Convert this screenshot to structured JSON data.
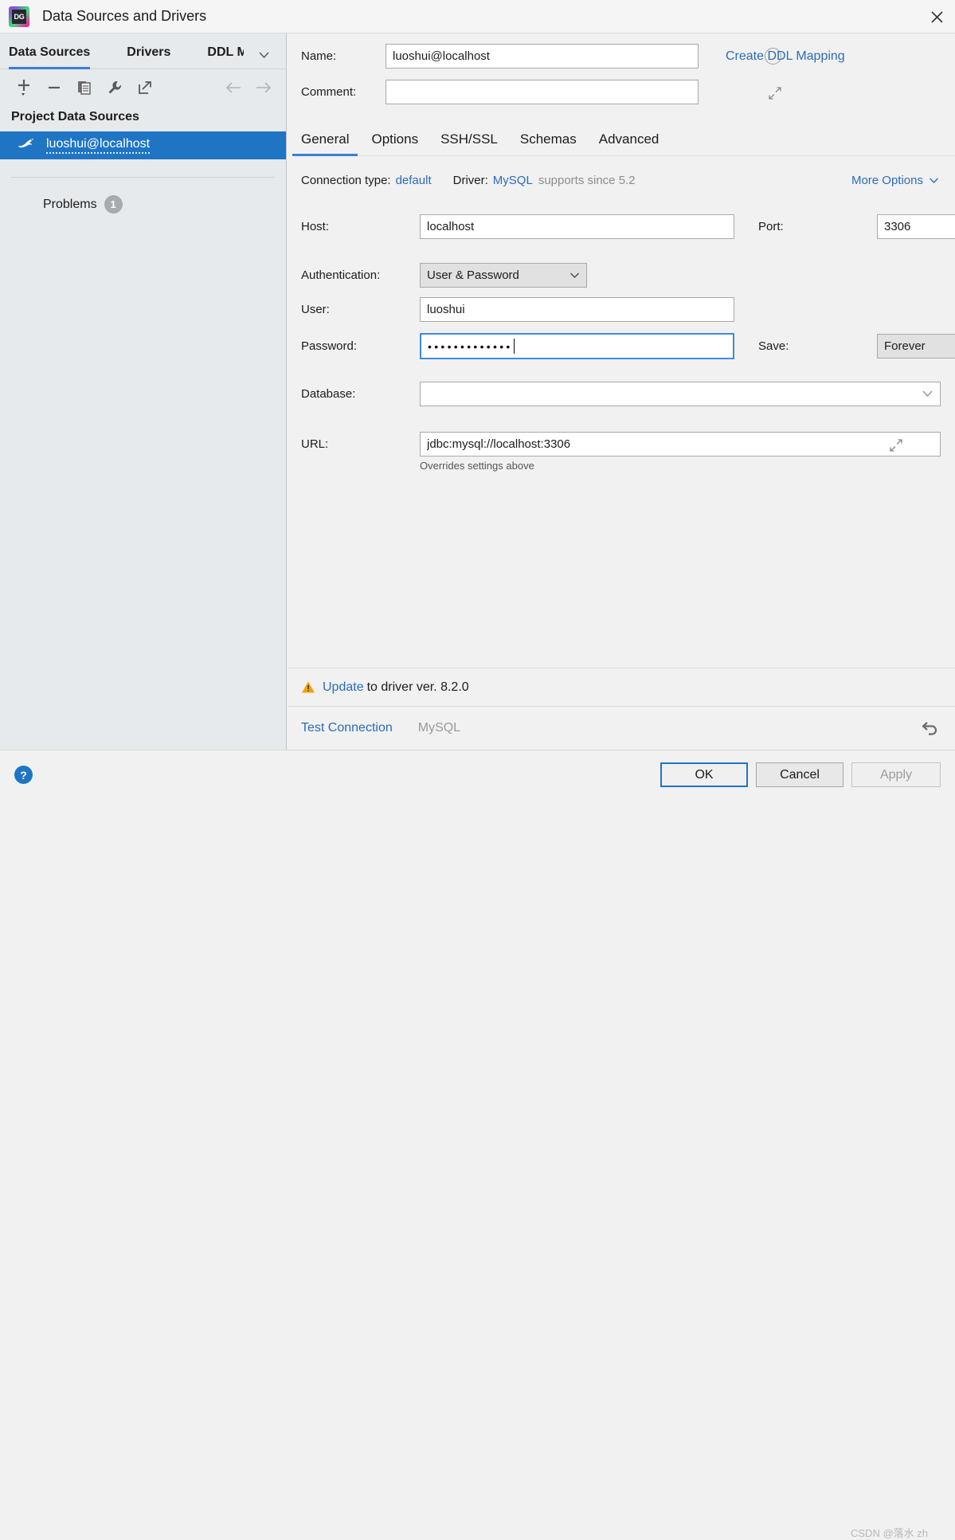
{
  "window": {
    "title": "Data Sources and Drivers",
    "logo_text": "DG",
    "close_icon": "close-icon"
  },
  "sidebar": {
    "tabs": [
      {
        "label": "Data Sources",
        "active": true
      },
      {
        "label": "Drivers",
        "active": false
      },
      {
        "label": "DDL M",
        "active": false
      }
    ],
    "overflow_icon": "chevron-down-icon",
    "toolbar": [
      {
        "name": "add-button",
        "icon": "plus-icon"
      },
      {
        "name": "remove-button",
        "icon": "minus-icon"
      },
      {
        "name": "duplicate-button",
        "icon": "copy-icon"
      },
      {
        "name": "properties-button",
        "icon": "wrench-icon"
      },
      {
        "name": "share-button",
        "icon": "external-link-icon"
      },
      {
        "name": "back-button",
        "icon": "arrow-left-icon"
      },
      {
        "name": "forward-button",
        "icon": "arrow-right-icon"
      }
    ],
    "section_title": "Project Data Sources",
    "data_source": {
      "label": "luoshui@localhost",
      "icon": "mysql-dolphin-icon",
      "selected": true
    },
    "problems": {
      "label": "Problems",
      "count": "1"
    }
  },
  "form": {
    "name_label": "Name:",
    "name_value": "luoshui@localhost",
    "name_color_icon": "color-circle-icon",
    "create_ddl_mapping": "Create DDL Mapping",
    "comment_label": "Comment:",
    "comment_value": "",
    "comment_expand_icon": "expand-icon",
    "tabs": [
      {
        "label": "General",
        "active": true
      },
      {
        "label": "Options",
        "active": false
      },
      {
        "label": "SSH/SSL",
        "active": false
      },
      {
        "label": "Schemas",
        "active": false
      },
      {
        "label": "Advanced",
        "active": false
      }
    ],
    "connection_type_label": "Connection type:",
    "connection_type_value": "default",
    "driver_label": "Driver:",
    "driver_value": "MySQL",
    "driver_note": "supports since 5.2",
    "more_options": "More Options",
    "more_options_icon": "chevron-down-icon",
    "host_label": "Host:",
    "host_value": "localhost",
    "port_label": "Port:",
    "port_value": "3306",
    "auth_label": "Authentication:",
    "auth_value": "User & Password",
    "user_label": "User:",
    "user_value": "luoshui",
    "password_label": "Password:",
    "password_masked": "•••••••••••••",
    "save_label": "Save:",
    "save_value": "Forever",
    "database_label": "Database:",
    "database_value": "",
    "url_label": "URL:",
    "url_value": "jdbc:mysql://localhost:3306",
    "url_expand_icon": "expand-icon",
    "url_hint": "Overrides settings above"
  },
  "status": {
    "warning_icon": "warning-triangle-icon",
    "update_link": "Update",
    "update_rest": "to driver ver. 8.2.0",
    "test_connection": "Test Connection",
    "test_driver": "MySQL",
    "revert_icon": "revert-icon"
  },
  "footer": {
    "help_label": "?",
    "ok_label": "OK",
    "cancel_label": "Cancel",
    "apply_label": "Apply"
  },
  "watermark": "CSDN @落水 zh",
  "colors": {
    "accent": "#1f75c4",
    "link": "#2b6cb8",
    "selection": "#1f75c4",
    "warning": "#f0a30a",
    "sidebar_bg": "#e6eaed",
    "panel_bg": "#f1f1f1"
  }
}
